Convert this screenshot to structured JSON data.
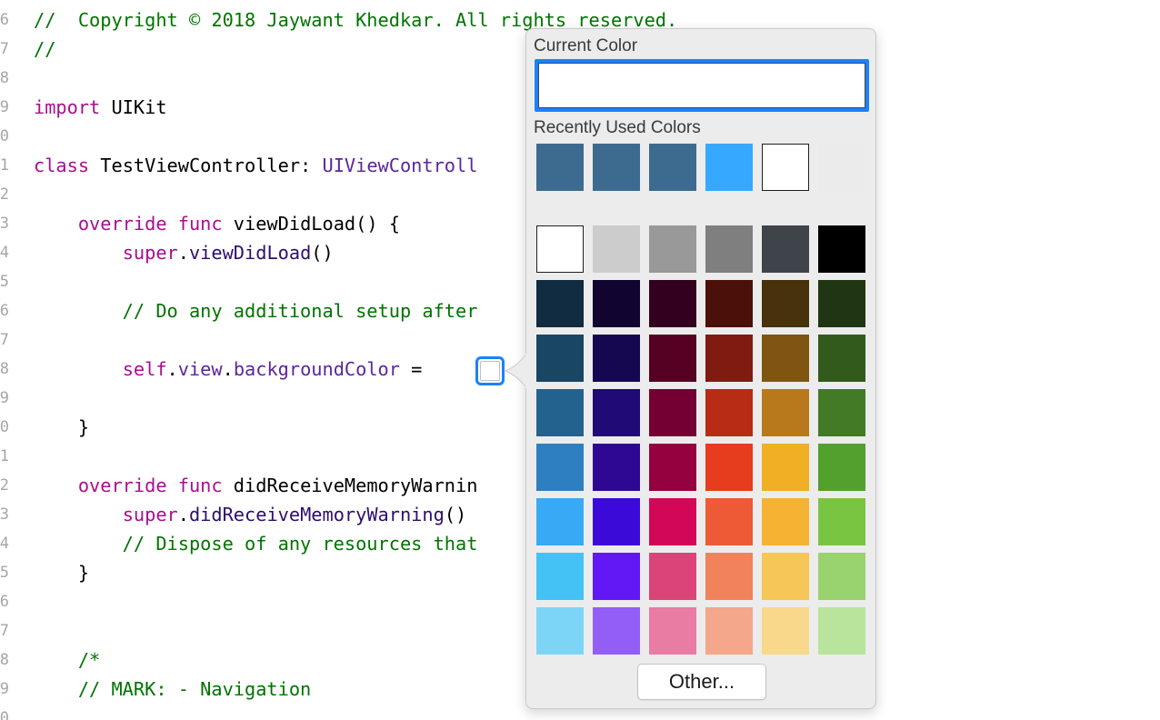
{
  "editor": {
    "lines": [
      {
        "num": "6",
        "tokens": [
          {
            "t": "//  Copyright © 2018 Jaywant Khedkar. All rights reserved.",
            "k": "comment"
          }
        ]
      },
      {
        "num": "7",
        "tokens": [
          {
            "t": "//",
            "k": "comment"
          }
        ]
      },
      {
        "num": "8",
        "tokens": []
      },
      {
        "num": "9",
        "tokens": [
          {
            "t": "import",
            "k": "keyword"
          },
          {
            "t": " UIKit",
            "k": "plain"
          }
        ]
      },
      {
        "num": "0",
        "tokens": []
      },
      {
        "num": "1",
        "tokens": [
          {
            "t": "class",
            "k": "keyword"
          },
          {
            "t": " TestViewController: ",
            "k": "plain"
          },
          {
            "t": "UIViewControll",
            "k": "type"
          }
        ]
      },
      {
        "num": "2",
        "tokens": []
      },
      {
        "num": "3",
        "tokens": [
          {
            "t": "    ",
            "k": "plain"
          },
          {
            "t": "override",
            "k": "keyword"
          },
          {
            "t": " ",
            "k": "plain"
          },
          {
            "t": "func",
            "k": "keyword"
          },
          {
            "t": " viewDidLoad() {",
            "k": "plain"
          }
        ]
      },
      {
        "num": "4",
        "tokens": [
          {
            "t": "        ",
            "k": "plain"
          },
          {
            "t": "super",
            "k": "keyword"
          },
          {
            "t": ".",
            "k": "plain"
          },
          {
            "t": "viewDidLoad",
            "k": "method"
          },
          {
            "t": "()",
            "k": "plain"
          }
        ]
      },
      {
        "num": "5",
        "tokens": []
      },
      {
        "num": "6",
        "tokens": [
          {
            "t": "        // Do any additional setup after",
            "k": "comment"
          }
        ]
      },
      {
        "num": "7",
        "tokens": []
      },
      {
        "num": "8",
        "tokens": [
          {
            "t": "        ",
            "k": "plain"
          },
          {
            "t": "self",
            "k": "keyword"
          },
          {
            "t": ".",
            "k": "plain"
          },
          {
            "t": "view",
            "k": "type"
          },
          {
            "t": ".",
            "k": "plain"
          },
          {
            "t": "backgroundColor",
            "k": "type"
          },
          {
            "t": " = ",
            "k": "plain"
          }
        ]
      },
      {
        "num": "9",
        "tokens": []
      },
      {
        "num": "0",
        "tokens": [
          {
            "t": "    }",
            "k": "plain"
          }
        ]
      },
      {
        "num": "1",
        "tokens": []
      },
      {
        "num": "2",
        "tokens": [
          {
            "t": "    ",
            "k": "plain"
          },
          {
            "t": "override",
            "k": "keyword"
          },
          {
            "t": " ",
            "k": "plain"
          },
          {
            "t": "func",
            "k": "keyword"
          },
          {
            "t": " didReceiveMemoryWarnin",
            "k": "plain"
          }
        ]
      },
      {
        "num": "3",
        "tokens": [
          {
            "t": "        ",
            "k": "plain"
          },
          {
            "t": "super",
            "k": "keyword"
          },
          {
            "t": ".",
            "k": "plain"
          },
          {
            "t": "didReceiveMemoryWarning",
            "k": "method"
          },
          {
            "t": "()",
            "k": "plain"
          }
        ]
      },
      {
        "num": "4",
        "tokens": [
          {
            "t": "        // Dispose of any resources that",
            "k": "comment"
          }
        ]
      },
      {
        "num": "5",
        "tokens": [
          {
            "t": "    }",
            "k": "plain"
          }
        ]
      },
      {
        "num": "6",
        "tokens": []
      },
      {
        "num": "7",
        "tokens": []
      },
      {
        "num": "8",
        "tokens": [
          {
            "t": "    /*",
            "k": "comment"
          }
        ]
      },
      {
        "num": "9",
        "tokens": [
          {
            "t": "    // MARK: - Navigation",
            "k": "comment"
          }
        ]
      },
      {
        "num": "0",
        "tokens": []
      }
    ],
    "color_literal": {
      "color": "#ffffff"
    }
  },
  "popover": {
    "current_color_label": "Current Color",
    "current_color": "#ffffff",
    "recent_label": "Recently Used Colors",
    "recent_colors": [
      "#3d6b8f",
      "#3d6b8f",
      "#3d6b8f",
      "#37a8ff",
      "#ffffff",
      "#ebebeb"
    ],
    "palette": [
      [
        "#ffffff",
        "#cccccc",
        "#999999",
        "#7f7f7f",
        "#3f444b",
        "#000000"
      ],
      [
        "#112b40",
        "#110430",
        "#33011f",
        "#4a1009",
        "#48320b",
        "#203612"
      ],
      [
        "#194663",
        "#160850",
        "#560124",
        "#801b11",
        "#7f5511",
        "#325a1c"
      ],
      [
        "#23628f",
        "#1f0a76",
        "#740033",
        "#b82b15",
        "#b8791c",
        "#427a26"
      ],
      [
        "#2e7fc1",
        "#2e0892",
        "#95003f",
        "#e63d1f",
        "#f0af24",
        "#54a02e"
      ],
      [
        "#38a9f4",
        "#3b0ad8",
        "#d30757",
        "#ed5a35",
        "#f5b233",
        "#79c542"
      ],
      [
        "#44c2f5",
        "#6218f4",
        "#db4479",
        "#f0835c",
        "#f6c658",
        "#98d36e"
      ],
      [
        "#7dd5f6",
        "#935ef6",
        "#e97ca3",
        "#f4a78a",
        "#f8d98b",
        "#b9e49b"
      ]
    ],
    "other_button": "Other..."
  }
}
